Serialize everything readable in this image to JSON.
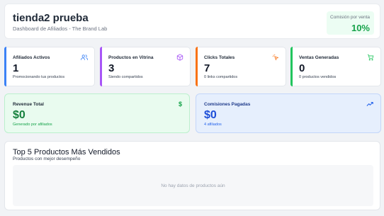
{
  "header": {
    "store_name": "tienda2 prueba",
    "subtitle": "Dashboard de Afiliados - The Brand Lab",
    "commission_label": "Comisión por venta",
    "commission_value": "10%"
  },
  "stats": [
    {
      "title": "Afiliados Activos",
      "value": "1",
      "desc": "Promocionando tus productos",
      "icon": "users-icon",
      "accent": "#3b82f6"
    },
    {
      "title": "Productos en Vitrina",
      "value": "3",
      "desc": "Siendo compartidos",
      "icon": "box-icon",
      "accent": "#a855f7"
    },
    {
      "title": "Clicks Totales",
      "value": "7",
      "desc": "0 links compartidos",
      "icon": "cursor-click-icon",
      "accent": "#f97316"
    },
    {
      "title": "Ventas Generadas",
      "value": "0",
      "desc": "0 productos vendidos",
      "icon": "cart-icon",
      "accent": "#22c55e"
    }
  ],
  "revenue": {
    "title": "Revenue Total",
    "value": "$0",
    "desc": "Generado por afiliados",
    "icon": "$"
  },
  "commissions": {
    "title": "Comisiones Pagadas",
    "value": "$0",
    "desc": "4 afiliados",
    "icon": "trending-up-icon"
  },
  "top_products": {
    "title": "Top 5 Productos Más Vendidos",
    "subtitle": "Productos con mejor desempeño",
    "empty_text": "No hay datos de productos aún"
  }
}
